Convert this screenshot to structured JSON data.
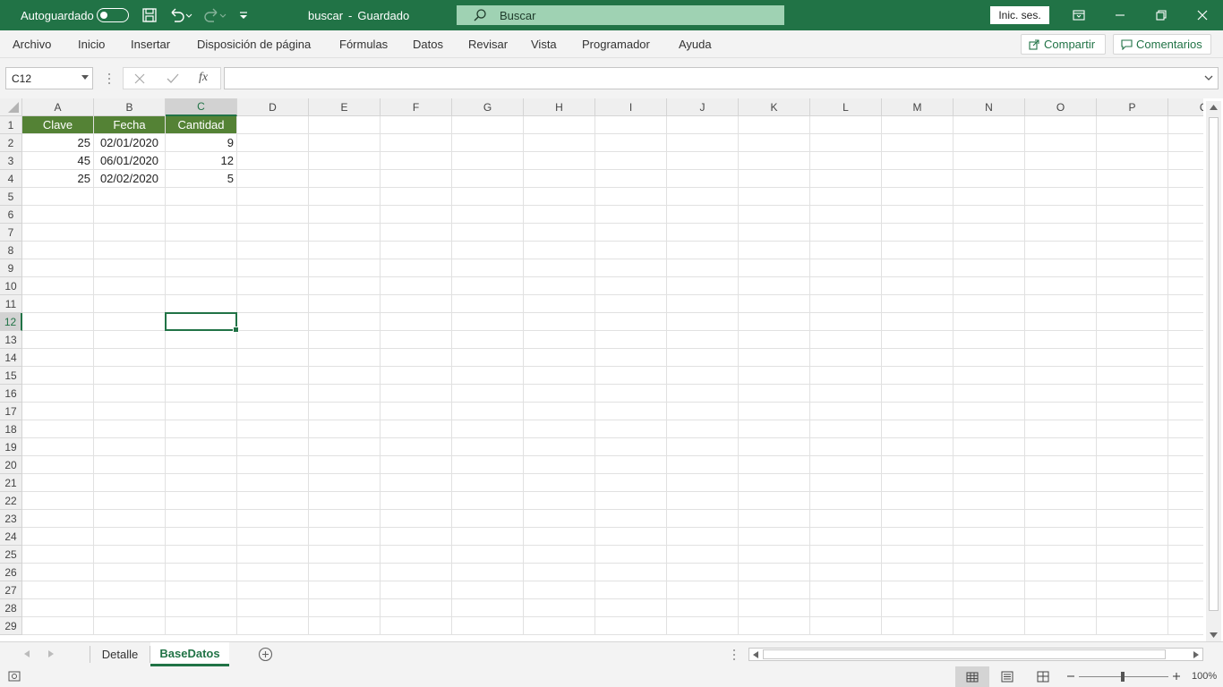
{
  "titlebar": {
    "autosave_label": "Autoguardado",
    "doc_title": "buscar",
    "doc_sep": "-",
    "doc_status": "Guardado",
    "search_placeholder": "Buscar",
    "signin_label": "Inic. ses."
  },
  "menu": {
    "items": [
      "Archivo",
      "Inicio",
      "Insertar",
      "Disposición de página",
      "Fórmulas",
      "Datos",
      "Revisar",
      "Vista",
      "Programador",
      "Ayuda"
    ],
    "share_label": "Compartir",
    "comments_label": "Comentarios"
  },
  "formula": {
    "name_box": "C12",
    "fx_label": "fx",
    "value": ""
  },
  "grid": {
    "columns": [
      "A",
      "B",
      "C",
      "D",
      "E",
      "F",
      "G",
      "H",
      "I",
      "J",
      "K",
      "L",
      "M",
      "N",
      "O",
      "P",
      "Q"
    ],
    "row_count": 29,
    "selected_cell": "C12",
    "header_row": [
      "Clave",
      "Fecha",
      "Cantidad"
    ],
    "rows": [
      [
        "25",
        "02/01/2020",
        "9"
      ],
      [
        "45",
        "06/01/2020",
        "12"
      ],
      [
        "25",
        "02/02/2020",
        "5"
      ]
    ]
  },
  "sheets": {
    "tabs": [
      "Detalle",
      "BaseDatos"
    ],
    "active": "BaseDatos"
  },
  "status": {
    "zoom": "100%"
  },
  "colors": {
    "accent": "#217346",
    "header_fill": "#548235"
  }
}
